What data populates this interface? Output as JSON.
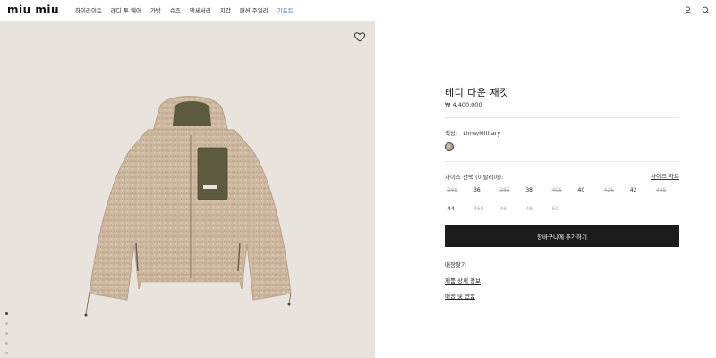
{
  "header": {
    "logo": "miu miu",
    "nav": [
      "하이라이트",
      "레디 투 웨어",
      "가방",
      "슈즈",
      "액세서리",
      "지갑",
      "패션 주얼리",
      "기프트"
    ],
    "icons": [
      "user-icon",
      "search-icon"
    ]
  },
  "gallery": {
    "slides": 5,
    "active_slide": 1
  },
  "product": {
    "title": "테디 다운 재킷",
    "price": "₩ 4,400,000",
    "color_label": "색상:",
    "color_value": "Lime/Military",
    "size_label": "사이즈 선택 (이탈리아):",
    "size_chart": "사이즈 차트",
    "sizes": [
      {
        "label": "36S",
        "available": false
      },
      {
        "label": "36",
        "available": true
      },
      {
        "label": "38S",
        "available": false
      },
      {
        "label": "38",
        "available": true
      },
      {
        "label": "40S",
        "available": false
      },
      {
        "label": "40",
        "available": true
      },
      {
        "label": "42S",
        "available": false
      },
      {
        "label": "42",
        "available": true
      },
      {
        "label": "44S",
        "available": false
      },
      {
        "label": "44",
        "available": true
      },
      {
        "label": "46S",
        "available": false
      },
      {
        "label": "46",
        "available": false
      },
      {
        "label": "48",
        "available": false
      },
      {
        "label": "50",
        "available": false
      }
    ],
    "add_to_cart": "장바구니에 추가하기",
    "links": [
      "매장찾기",
      "제품 상세 정보",
      "배송 및 반품"
    ]
  },
  "colors": {
    "accent_gift": "#4a6fb5",
    "button_bg": "#1c1c1c",
    "image_bg": "#e8e4dd",
    "jacket": "#cdb8a0",
    "pocket": "#5c5a3f"
  }
}
